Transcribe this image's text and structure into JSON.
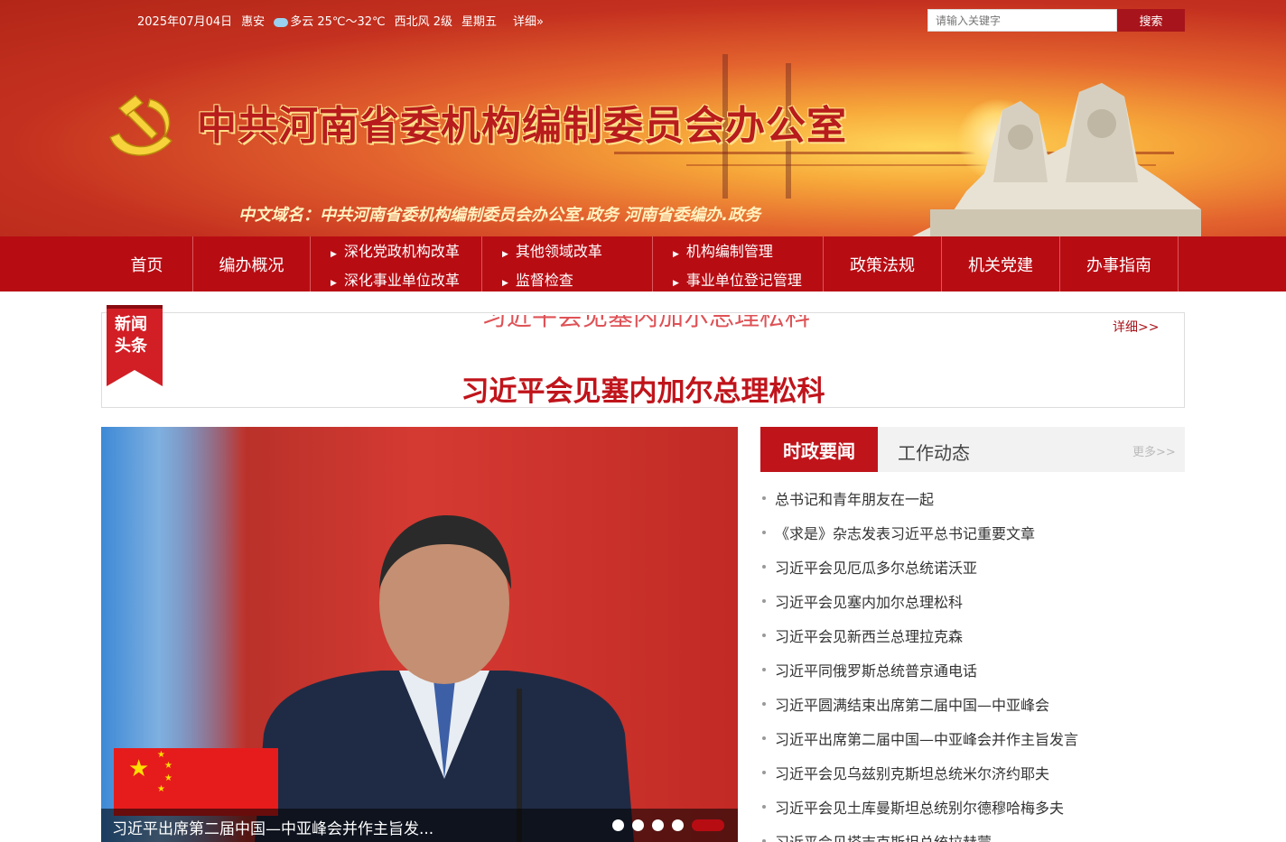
{
  "topbar": {
    "date": "2025年07月04日",
    "city": "惠安",
    "weather": "多云 25℃～32℃",
    "wind": "西北风 2级",
    "weekday": "星期五",
    "detail": "详细»"
  },
  "search": {
    "placeholder": "请输入关键字",
    "button": "搜索"
  },
  "site": {
    "title": "中共河南省委机构编制委员会办公室",
    "domain": "中文域名：中共河南省委机构编制委员会办公室.政务  河南省委编办.政务"
  },
  "nav": {
    "home": "首页",
    "overview": "编办概况",
    "reform_party": "深化党政机构改革",
    "reform_units": "深化事业单位改革",
    "reform_other": "其他领域改革",
    "inspection": "监督检查",
    "org_management": "机构编制管理",
    "unit_registration": "事业单位登记管理",
    "policy": "政策法规",
    "party_building": "机关党建",
    "guide": "办事指南"
  },
  "headline": {
    "badge_line1": "新闻",
    "badge_line2": "头条",
    "more": "详细>>",
    "title": "习近平会见塞内加尔总理松科"
  },
  "slider": {
    "caption": "习近平出席第二届中国—中亚峰会并作主旨发...",
    "dot_count": 5,
    "active_dot": 5
  },
  "news": {
    "tab_active": "时政要闻",
    "tab_other": "工作动态",
    "more": "更多>>",
    "items": [
      "总书记和青年朋友在一起",
      "《求是》杂志发表习近平总书记重要文章",
      "习近平会见厄瓜多尔总统诺沃亚",
      "习近平会见塞内加尔总理松科",
      "习近平会见新西兰总理拉克森",
      "习近平同俄罗斯总统普京通电话",
      "习近平圆满结束出席第二届中国—中亚峰会",
      "习近平出席第二届中国—中亚峰会并作主旨发言",
      "习近平会见乌兹别克斯坦总统米尔济约耶夫",
      "习近平会见土库曼斯坦总统别尔德穆哈梅多夫",
      "习近平会见塔吉克斯坦总统拉赫蒙"
    ]
  },
  "colors": {
    "primary_red": "#b80c13",
    "accent_red": "#c0141b"
  }
}
